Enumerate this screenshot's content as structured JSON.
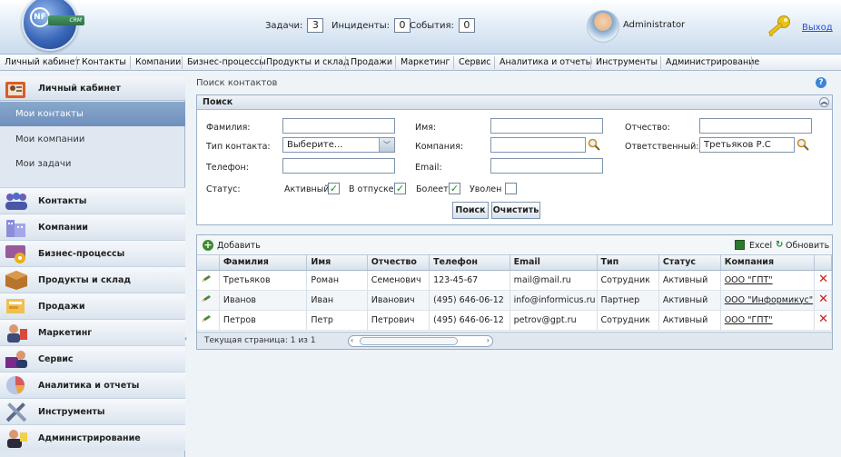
{
  "header": {
    "logo_text": "NF",
    "logo_sub": "CRM",
    "tasks_label": "Задачи:",
    "tasks_count": "3",
    "incidents_label": "Инциденты:",
    "incidents_count": "0",
    "events_label": "События:",
    "events_count": "0",
    "user_name": "Administrator",
    "logout_label": "Выход"
  },
  "top_menu": [
    "Личный кабинет",
    "Контакты",
    "Компании",
    "Бизнес-процессы",
    "Продукты и склад",
    "Продажи",
    "Маркетинг",
    "Сервис",
    "Аналитика и отчеты",
    "Инструменты",
    "Администрирование"
  ],
  "sidebar": {
    "head_label": "Личный кабинет",
    "sub_items": [
      "Мои контакты",
      "Мои компании",
      "Мои задачи"
    ],
    "items": [
      "Контакты",
      "Компании",
      "Бизнес-процессы",
      "Продукты и склад",
      "Продажи",
      "Маркетинг",
      "Сервис",
      "Аналитика и отчеты",
      "Инструменты",
      "Администрирование"
    ]
  },
  "breadcrumb": "Поиск контактов",
  "search": {
    "title": "Поиск",
    "lastname_label": "Фамилия:",
    "firstname_label": "Имя:",
    "middlename_label": "Отчество:",
    "contact_type_label": "Тип контакта:",
    "contact_type_value": "Выберите...",
    "company_label": "Компания:",
    "responsible_label": "Ответственный:",
    "responsible_value": "Третьяков Р.С",
    "phone_label": "Телефон:",
    "email_label": "Email:",
    "status_label": "Статус:",
    "status_active": "Активный",
    "status_vacation": "В отпуске",
    "status_sick": "Болеет",
    "status_fired": "Уволен",
    "search_button": "Поиск",
    "clear_button": "Очистить"
  },
  "grid": {
    "add_label": "Добавить",
    "excel_label": "Excel",
    "refresh_label": "Обновить",
    "columns": [
      "Фамилия",
      "Имя",
      "Отчество",
      "Телефон",
      "Email",
      "Тип",
      "Статус",
      "Компания"
    ],
    "rows": [
      [
        "Третьяков",
        "Роман",
        "Семенович",
        "123-45-67",
        "mail@mail.ru",
        "Сотрудник",
        "Активный",
        "ООО \"ГПТ\""
      ],
      [
        "Иванов",
        "Иван",
        "Иванович",
        "(495) 646-06-12",
        "info@informicus.ru",
        "Партнер",
        "Активный",
        "ООО \"Информикус\""
      ],
      [
        "Петров",
        "Петр",
        "Петрович",
        "(495) 646-06-12",
        "petrov@gpt.ru",
        "Сотрудник",
        "Активный",
        "ООО \"ГПТ\""
      ]
    ],
    "pager_text": "Текущая страница: 1 из 1"
  }
}
